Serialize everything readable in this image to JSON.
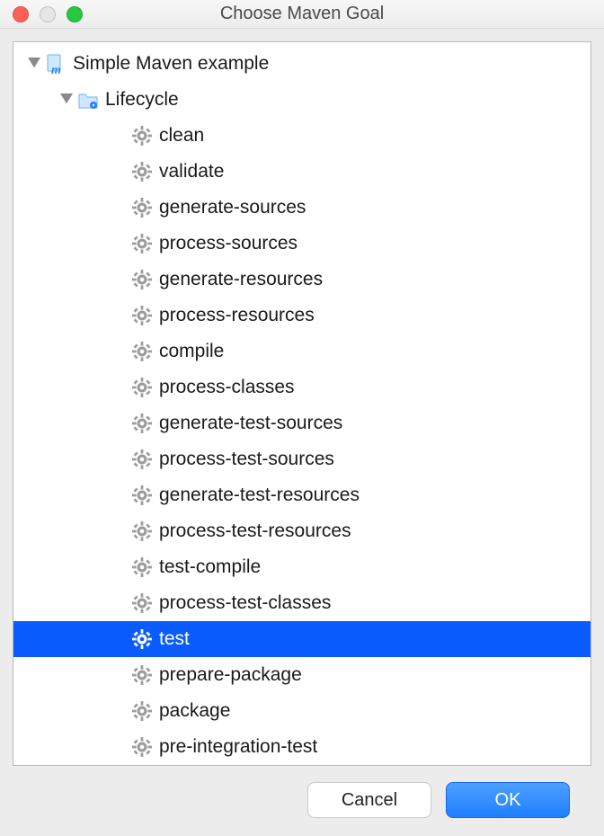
{
  "window": {
    "title": "Choose Maven Goal"
  },
  "tree": {
    "root": {
      "label": "Simple Maven example",
      "expanded": true
    },
    "lifecycle": {
      "label": "Lifecycle",
      "expanded": true
    },
    "goals": [
      {
        "label": "clean",
        "selected": false
      },
      {
        "label": "validate",
        "selected": false
      },
      {
        "label": "generate-sources",
        "selected": false
      },
      {
        "label": "process-sources",
        "selected": false
      },
      {
        "label": "generate-resources",
        "selected": false
      },
      {
        "label": "process-resources",
        "selected": false
      },
      {
        "label": "compile",
        "selected": false
      },
      {
        "label": "process-classes",
        "selected": false
      },
      {
        "label": "generate-test-sources",
        "selected": false
      },
      {
        "label": "process-test-sources",
        "selected": false
      },
      {
        "label": "generate-test-resources",
        "selected": false
      },
      {
        "label": "process-test-resources",
        "selected": false
      },
      {
        "label": "test-compile",
        "selected": false
      },
      {
        "label": "process-test-classes",
        "selected": false
      },
      {
        "label": "test",
        "selected": true
      },
      {
        "label": "prepare-package",
        "selected": false
      },
      {
        "label": "package",
        "selected": false
      },
      {
        "label": "pre-integration-test",
        "selected": false
      }
    ]
  },
  "buttons": {
    "cancel": "Cancel",
    "ok": "OK"
  }
}
